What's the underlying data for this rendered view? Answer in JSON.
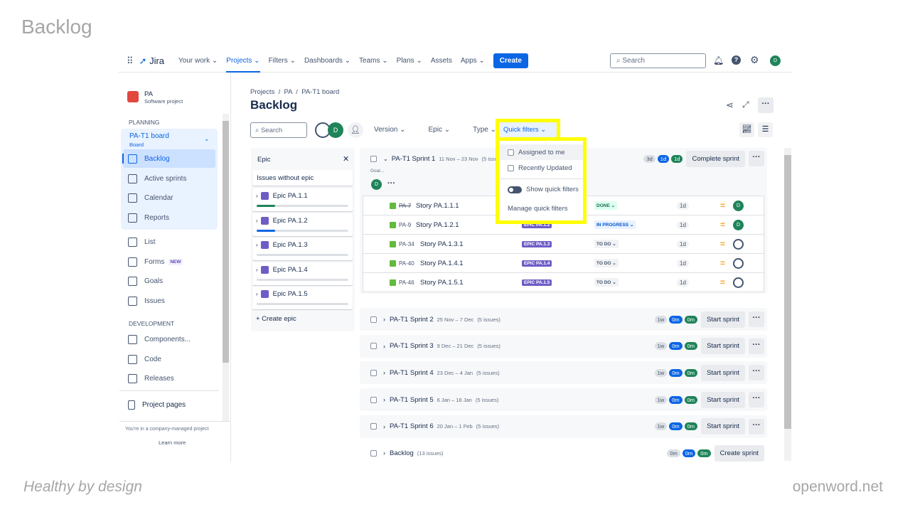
{
  "slide": {
    "title": "Backlog",
    "footer_left": "Healthy by design",
    "footer_right": "openword.net"
  },
  "nav": {
    "logo": "Jira",
    "items": [
      "Your work ⌄",
      "Projects ⌄",
      "Filters ⌄",
      "Dashboards ⌄",
      "Teams ⌄",
      "Plans ⌄",
      "Assets",
      "Apps ⌄"
    ],
    "create": "Create",
    "search_placeholder": "Search",
    "avatar": "D"
  },
  "sidebar": {
    "project_name": "PA",
    "project_type": "Software project",
    "planning": "PLANNING",
    "board": "PA-T1 board",
    "board_sub": "Board",
    "planning_items": [
      "Backlog",
      "Active sprints",
      "Calendar",
      "Reports"
    ],
    "other_items": [
      "List",
      "Forms",
      "Goals",
      "Issues"
    ],
    "forms_badge": "NEW",
    "development": "DEVELOPMENT",
    "dev_items": [
      "Components...",
      "Code",
      "Releases"
    ],
    "project_pages": "Project pages",
    "footer_text": "You're in a company-managed project",
    "learn_more": "Learn more"
  },
  "main": {
    "breadcrumb": [
      "Projects",
      "PA",
      "PA-T1 board"
    ],
    "title": "Backlog",
    "search_placeholder": "Search",
    "avatar": "D",
    "filters": [
      "Version ⌄",
      "Epic ⌄",
      "Type ⌄"
    ],
    "quick_filters": "Quick filters ⌄"
  },
  "quick_filters_menu": {
    "items": [
      "Assigned to me",
      "Recently Updated"
    ],
    "toggle": "Show quick filters",
    "manage": "Manage quick filters"
  },
  "epic_panel": {
    "title": "Epic",
    "no_epic": "Issues without epic",
    "epics": [
      {
        "name": "Epic PA.1.1",
        "progress_color": "#1f845a",
        "progress": 0.2
      },
      {
        "name": "Epic PA.1.2",
        "progress_color": "#0c66e4",
        "progress": 0.2
      },
      {
        "name": "Epic PA.1.3",
        "progress": 0
      },
      {
        "name": "Epic PA.1.4",
        "progress": 0
      },
      {
        "name": "Epic PA.1.5",
        "progress": 0
      }
    ],
    "create": "+ Create epic"
  },
  "sprint1": {
    "name": "PA-T1 Sprint 1",
    "dates": "11 Nov – 23 Nov",
    "count": "(5 issues)",
    "goal": "Goal...",
    "avatar": "D",
    "pills": [
      "3d",
      "1d",
      "1d"
    ],
    "action": "Complete sprint",
    "issues": [
      {
        "key": "PA-7",
        "summary": "Story PA.1.1.1",
        "epic": "",
        "status": "DONE ⌄",
        "est": "1d",
        "assignee": "D",
        "done": true
      },
      {
        "key": "PA-9",
        "summary": "Story PA.1.2.1",
        "epic": "EPIC PA.1.2",
        "status": "IN PROGRESS ⌄",
        "est": "1d",
        "assignee": "D"
      },
      {
        "key": "PA-34",
        "summary": "Story PA.1.3.1",
        "epic": "EPIC PA.1.3",
        "status": "TO DO ⌄",
        "est": "1d",
        "assignee": ""
      },
      {
        "key": "PA-40",
        "summary": "Story PA.1.4.1",
        "epic": "EPIC PA.1.4",
        "status": "TO DO ⌄",
        "est": "1d",
        "assignee": ""
      },
      {
        "key": "PA-46",
        "summary": "Story PA.1.5.1",
        "epic": "EPIC PA.1.5",
        "status": "TO DO ⌄",
        "est": "1d",
        "assignee": ""
      }
    ]
  },
  "sprints": [
    {
      "name": "PA-T1 Sprint 2",
      "dates": "25 Nov – 7 Dec",
      "count": "(5 issues)",
      "pills": [
        "1w",
        "0m",
        "0m"
      ],
      "action": "Start sprint"
    },
    {
      "name": "PA-T1 Sprint 3",
      "dates": "9 Dec – 21 Dec",
      "count": "(5 issues)",
      "pills": [
        "1w",
        "0m",
        "0m"
      ],
      "action": "Start sprint"
    },
    {
      "name": "PA-T1 Sprint 4",
      "dates": "23 Dec – 4 Jan",
      "count": "(5 issues)",
      "pills": [
        "1w",
        "0m",
        "0m"
      ],
      "action": "Start sprint"
    },
    {
      "name": "PA-T1 Sprint 5",
      "dates": "6 Jan – 18 Jan",
      "count": "(5 issues)",
      "pills": [
        "1w",
        "0m",
        "0m"
      ],
      "action": "Start sprint"
    },
    {
      "name": "PA-T1 Sprint 6",
      "dates": "20 Jan – 1 Feb",
      "count": "(5 issues)",
      "pills": [
        "1w",
        "0m",
        "0m"
      ],
      "action": "Start sprint"
    }
  ],
  "backlog": {
    "name": "Backlog",
    "count": "(13 issues)",
    "pills": [
      "0m",
      "0m",
      "0m"
    ],
    "action": "Create sprint"
  },
  "colors": {
    "accent": "#0c66e4",
    "highlight": "#ffff00",
    "epic": "#6e5dc6",
    "done": "#1f845a"
  }
}
